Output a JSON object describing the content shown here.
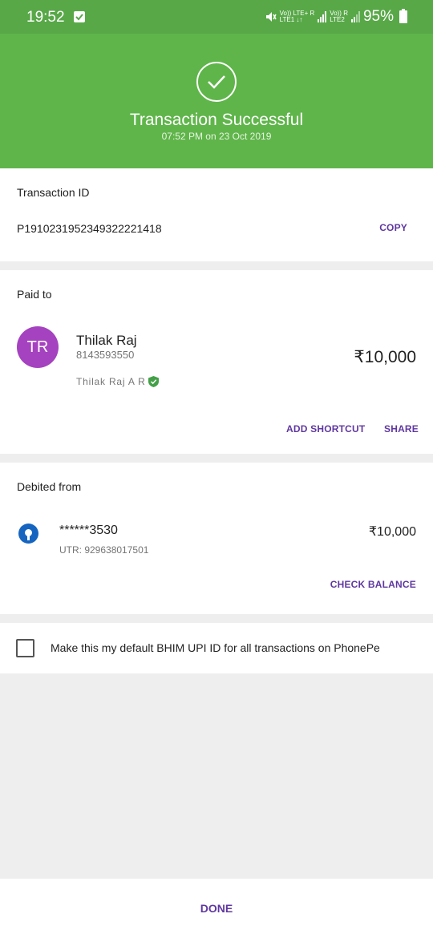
{
  "status_bar": {
    "time": "19:52",
    "net1_top": "Vo)) LTE+ R",
    "net1_bottom": "LTE1 ↓↑",
    "net2_top": "Vo)) R",
    "net2_bottom": "LTE2",
    "battery": "95%"
  },
  "header": {
    "title": "Transaction Successful",
    "subtitle": "07:52 PM on 23 Oct 2019",
    "color": "#5fb54a"
  },
  "transaction": {
    "label": "Transaction ID",
    "id": "P1910231952349322221418",
    "copy_label": "COPY"
  },
  "paid_to": {
    "label": "Paid to",
    "initials": "TR",
    "name": "Thilak Raj",
    "phone": "8143593550",
    "verified_name": "Thilak Raj A R",
    "amount": "₹10,000",
    "add_shortcut_label": "ADD SHORTCUT",
    "share_label": "SHARE"
  },
  "debited_from": {
    "label": "Debited from",
    "account": "******3530",
    "utr": "UTR: 929638017501",
    "amount": "₹10,000",
    "check_balance_label": "CHECK BALANCE"
  },
  "default_option": {
    "text": "Make this my default BHIM UPI ID for all transactions on PhonePe"
  },
  "footer": {
    "done_label": "DONE"
  }
}
